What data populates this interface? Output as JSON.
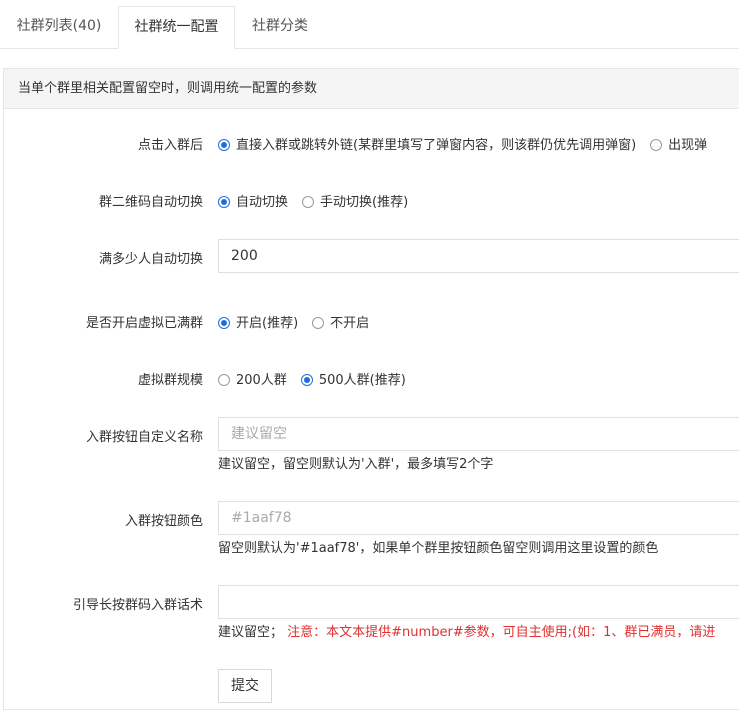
{
  "tabs": [
    {
      "label": "社群列表(40)"
    },
    {
      "label": "社群统一配置"
    },
    {
      "label": "社群分类"
    }
  ],
  "panel": {
    "header": "当单个群里相关配置留空时，则调用统一配置的参数"
  },
  "form": {
    "click_join": {
      "label": "点击入群后",
      "options": [
        "直接入群或跳转外链(某群里填写了弹窗内容，则该群仍优先调用弹窗)",
        "出现弹"
      ],
      "selected": 0
    },
    "qr_switch": {
      "label": "群二维码自动切换",
      "options": [
        "自动切换",
        "手动切换(推荐)"
      ],
      "selected": 0
    },
    "full_count": {
      "label": "满多少人自动切换",
      "value": "200"
    },
    "virtual_full": {
      "label": "是否开启虚拟已满群",
      "options": [
        "开启(推荐)",
        "不开启"
      ],
      "selected": 0
    },
    "virtual_size": {
      "label": "虚拟群规模",
      "options": [
        "200人群",
        "500人群(推荐)"
      ],
      "selected": 1
    },
    "btn_name": {
      "label": "入群按钮自定义名称",
      "placeholder": "建议留空",
      "help": "建议留空，留空则默认为'入群'，最多填写2个字"
    },
    "btn_color": {
      "label": "入群按钮颜色",
      "placeholder": "#1aaf78",
      "help": "留空则默认为'#1aaf78'，如果单个群里按钮颜色留空则调用这里设置的颜色"
    },
    "guide_text": {
      "label": "引导长按群码入群话术",
      "value": "",
      "help_prefix": "建议留空；",
      "help_note": "注意：本文本提供#number#参数，可自主使用;(如：1、群已满员，请进"
    },
    "submit_label": "提交"
  },
  "colors": {
    "accent": "#1e6fd9",
    "warning": "#e03030",
    "border": "#e6e6e6"
  }
}
